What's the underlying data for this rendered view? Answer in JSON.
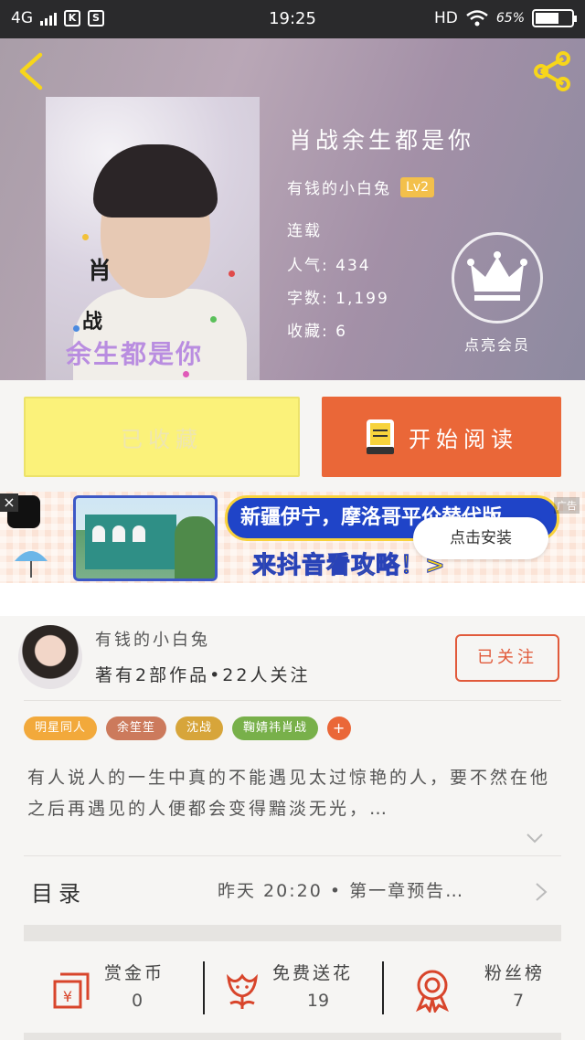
{
  "status_bar": {
    "network": "4G",
    "app_badge_1": "K",
    "app_badge_2": "S",
    "time": "19:25",
    "hd": "HD",
    "battery": "65%",
    "battery_level": 0.65
  },
  "book": {
    "title": "肖战余生都是你",
    "cover_text_1": "肖",
    "cover_text_2": "战",
    "cover_text_3": "余生都是你",
    "author": "有钱的小白兔",
    "level": "Lv2",
    "status": "连载",
    "popularity_label": "人气:",
    "popularity_value": "434",
    "words_label": "字数:",
    "words_value": "1,199",
    "favorites_label": "收藏:",
    "favorites_value": "6",
    "vip_label": "点亮会员"
  },
  "actions": {
    "collected_label": "已收藏",
    "read_label": "开始阅读"
  },
  "ad": {
    "close": "×",
    "headline": "新疆伊宁，摩洛哥平价替代版",
    "subline": "来抖音看攻略！>",
    "install_label": "点击安装",
    "tag": "广告"
  },
  "author_card": {
    "name": "有钱的小白兔",
    "subtitle": "著有2部作品•22人关注",
    "follow_label": "已关注"
  },
  "tags": [
    {
      "label": "明星同人",
      "color": "#f2a93b"
    },
    {
      "label": "余笙笙",
      "color": "#cc7a5c"
    },
    {
      "label": "沈战",
      "color": "#d7a53a"
    },
    {
      "label": "鞠婧祎肖战",
      "color": "#78b04a"
    },
    {
      "label": "+",
      "color": "#ea6738"
    }
  ],
  "description": "有人说人的一生中真的不能遇见太过惊艳的人，要不然在他之后再遇见的人便都会变得黯淡无光，…",
  "toc": {
    "label": "目录",
    "latest": "昨天 20:20 • 第一章预告…"
  },
  "stats": {
    "coins_label": "赏金币",
    "coins_value": "0",
    "flowers_label": "免费送花",
    "flowers_value": "19",
    "fans_label": "粉丝榜",
    "fans_value": "7"
  },
  "colors": {
    "accent_orange": "#ea6738",
    "collected_yellow": "#fbf27a",
    "follow_red": "#e15a3b",
    "icon_red": "#d8452b",
    "level_badge": "#f3c04b"
  }
}
